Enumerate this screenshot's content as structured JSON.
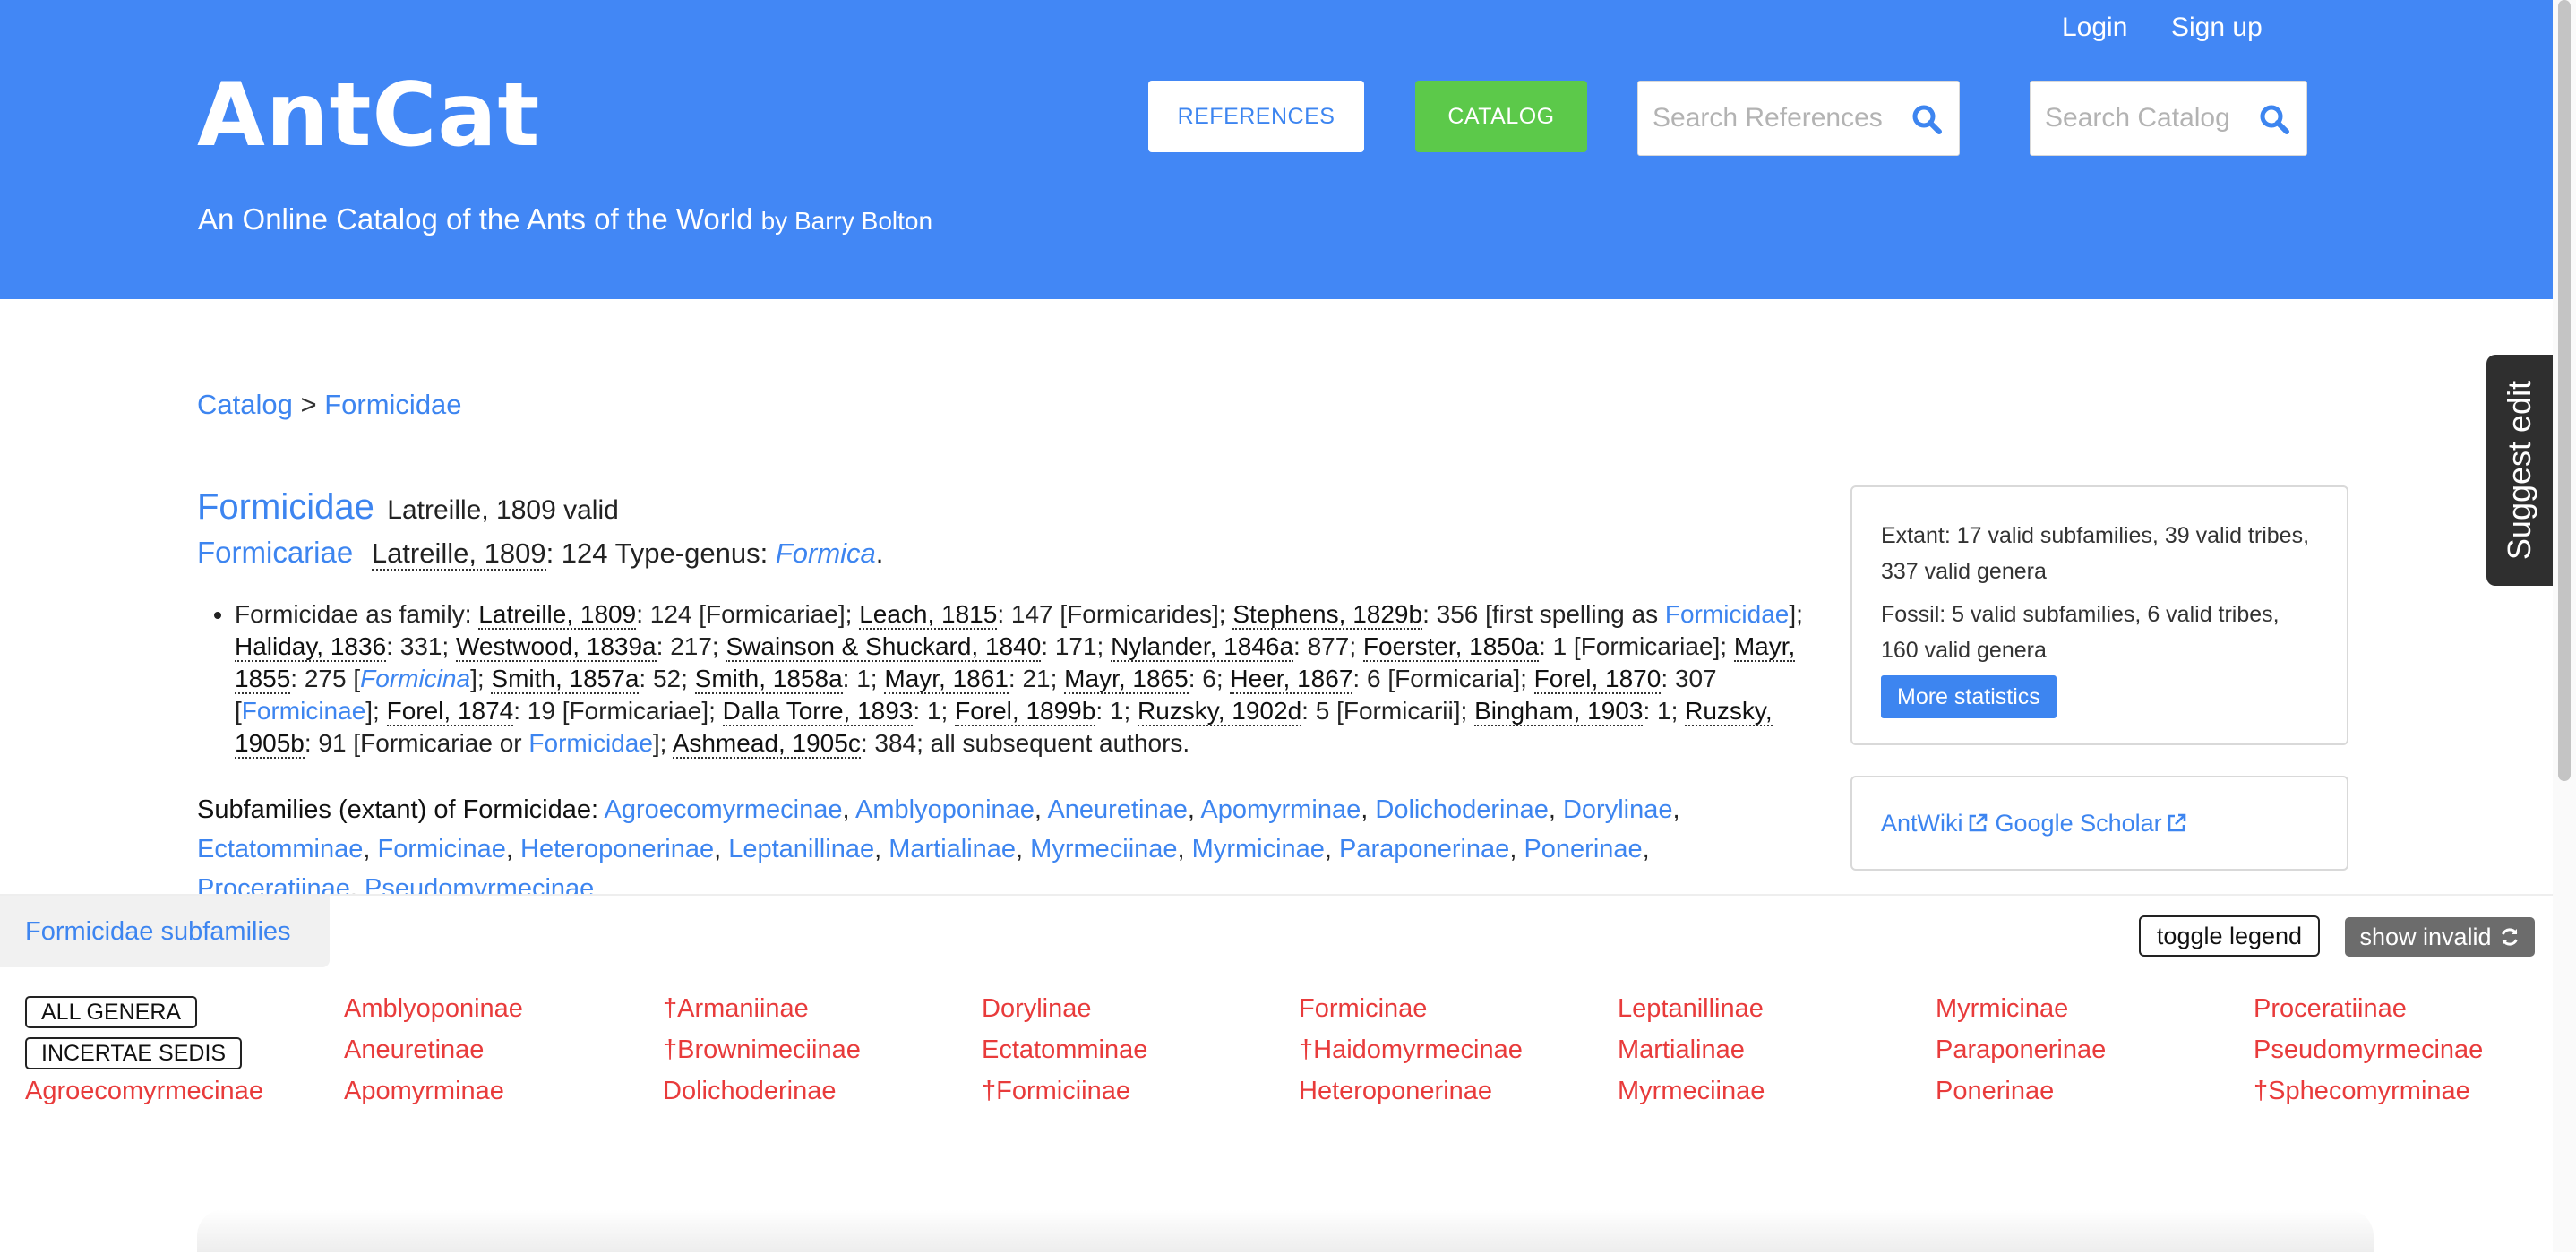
{
  "header": {
    "logo": "AntCat",
    "tagline": "An Online Catalog of the Ants of the World",
    "tagline_by": "by Barry Bolton",
    "login": "Login",
    "signup": "Sign up",
    "references_button": "REFERENCES",
    "catalog_button": "CATALOG",
    "search_references_placeholder": "Search References",
    "search_catalog_placeholder": "Search Catalog",
    "colors": {
      "header_bg": "#4287f5",
      "catalog_button": "#5cc94a"
    }
  },
  "breadcrumb": {
    "root": "Catalog",
    "sep": ">",
    "current": "Formicidae"
  },
  "taxon": {
    "name": "Formicidae",
    "author_status": "Latreille, 1809 valid",
    "protonym": "Formicariae",
    "protonym_ref": "Latreille, 1809",
    "protonym_page": ": 124 Type-genus: ",
    "type_genus": "Formica",
    "type_end": "."
  },
  "history": [
    {
      "t": "text",
      "v": "Formicidae as family: "
    },
    {
      "t": "ref",
      "v": "Latreille, 1809"
    },
    {
      "t": "text",
      "v": ": 124 [Formicariae]; "
    },
    {
      "t": "ref",
      "v": "Leach, 1815"
    },
    {
      "t": "text",
      "v": ": 147 [Formicarides]; "
    },
    {
      "t": "ref",
      "v": "Stephens, 1829b"
    },
    {
      "t": "text",
      "v": ": 356 [first spelling as "
    },
    {
      "t": "link",
      "v": "Formicidae"
    },
    {
      "t": "text",
      "v": "]; "
    },
    {
      "t": "ref",
      "v": "Haliday, 1836"
    },
    {
      "t": "text",
      "v": ": 331; "
    },
    {
      "t": "ref",
      "v": "Westwood, 1839a"
    },
    {
      "t": "text",
      "v": ": 217; "
    },
    {
      "t": "ref",
      "v": "Swainson & Shuckard, 1840"
    },
    {
      "t": "text",
      "v": ": 171; "
    },
    {
      "t": "ref",
      "v": "Nylander, 1846a"
    },
    {
      "t": "text",
      "v": ": 877; "
    },
    {
      "t": "ref",
      "v": "Foerster, 1850a"
    },
    {
      "t": "text",
      "v": ": 1 [Formicariae]; "
    },
    {
      "t": "ref",
      "v": "Mayr, 1855"
    },
    {
      "t": "text",
      "v": ": 275 ["
    },
    {
      "t": "ilink",
      "v": "Formicina"
    },
    {
      "t": "text",
      "v": "]; "
    },
    {
      "t": "ref",
      "v": "Smith, 1857a"
    },
    {
      "t": "text",
      "v": ": 52; "
    },
    {
      "t": "ref",
      "v": "Smith, 1858a"
    },
    {
      "t": "text",
      "v": ": 1; "
    },
    {
      "t": "ref",
      "v": "Mayr, 1861"
    },
    {
      "t": "text",
      "v": ": 21; "
    },
    {
      "t": "ref",
      "v": "Mayr, 1865"
    },
    {
      "t": "text",
      "v": ": 6; "
    },
    {
      "t": "ref",
      "v": "Heer, 1867"
    },
    {
      "t": "text",
      "v": ": 6 [Formicaria]; "
    },
    {
      "t": "ref",
      "v": "Forel, 1870"
    },
    {
      "t": "text",
      "v": ": 307 ["
    },
    {
      "t": "link",
      "v": "Formicinae"
    },
    {
      "t": "text",
      "v": "]; "
    },
    {
      "t": "ref",
      "v": "Forel, 1874"
    },
    {
      "t": "text",
      "v": ": 19 [Formicariae]; "
    },
    {
      "t": "ref",
      "v": "Dalla Torre, 1893"
    },
    {
      "t": "text",
      "v": ": 1; "
    },
    {
      "t": "ref",
      "v": "Forel, 1899b"
    },
    {
      "t": "text",
      "v": ": 1; "
    },
    {
      "t": "ref",
      "v": "Ruzsky, 1902d"
    },
    {
      "t": "text",
      "v": ": 5 [Formicarii]; "
    },
    {
      "t": "ref",
      "v": "Bingham, 1903"
    },
    {
      "t": "text",
      "v": ": 1; "
    },
    {
      "t": "ref",
      "v": "Ruzsky, 1905b"
    },
    {
      "t": "text",
      "v": ": 91 [Formicariae or "
    },
    {
      "t": "link",
      "v": "Formicidae"
    },
    {
      "t": "text",
      "v": "]; "
    },
    {
      "t": "ref",
      "v": "Ashmead, 1905c"
    },
    {
      "t": "text",
      "v": ": 384; all subsequent authors."
    }
  ],
  "subfamilies_extant": {
    "label": "Subfamilies (extant) of Formicidae:",
    "items": [
      "Agroecomyrmecinae",
      "Amblyoponinae",
      "Aneuretinae",
      "Apomyrminae",
      "Dolichoderinae",
      "Dorylinae",
      "Ectatomminae",
      "Formicinae",
      "Heteroponerinae",
      "Leptanillinae",
      "Martialinae",
      "Myrmeciinae",
      "Myrmicinae",
      "Paraponerinae",
      "Ponerinae",
      "Proceratiinae",
      "Pseudomyrmecinae"
    ]
  },
  "stats": {
    "extant": "Extant: 17 valid subfamilies, 39 valid tribes, 337 valid genera",
    "fossil": "Fossil: 5 valid subfamilies, 6 valid tribes, 160 valid genera",
    "button": "More statistics"
  },
  "external_links": {
    "antwiki": "AntWiki",
    "scholar": "Google Scholar"
  },
  "suggest_edit": "Suggest edit",
  "bottom_panel": {
    "tab": "Formicidae subfamilies",
    "toggle_legend": "toggle legend",
    "show_invalid": "show invalid",
    "all_genera": "ALL GENERA",
    "incertae_sedis": "INCERTAE SEDIS",
    "link_color": "#e83b3b",
    "columns": [
      [
        "",
        "",
        "Agroecomyrmecinae"
      ],
      [
        "Amblyoponinae",
        "Aneuretinae",
        "Apomyrminae"
      ],
      [
        "†Armaniinae",
        "†Brownimeciinae",
        "Dolichoderinae"
      ],
      [
        "Dorylinae",
        "Ectatomminae",
        "†Formiciinae"
      ],
      [
        "Formicinae",
        "†Haidomyrmecinae",
        "Heteroponerinae"
      ],
      [
        "Leptanillinae",
        "Martialinae",
        "Myrmeciinae"
      ],
      [
        "Myrmicinae",
        "Paraponerinae",
        "Ponerinae"
      ],
      [
        "Proceratiinae",
        "Pseudomyrmecinae",
        "†Sphecomyrminae"
      ]
    ]
  }
}
